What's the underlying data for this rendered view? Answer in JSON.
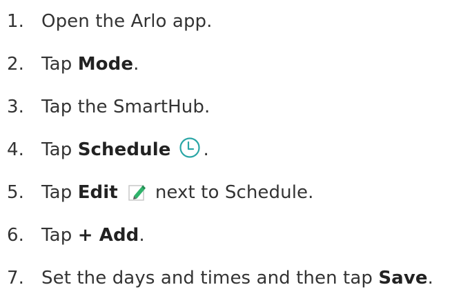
{
  "steps": [
    {
      "num": "1.",
      "text": "Open the Arlo app."
    },
    {
      "num": "2.",
      "pre": "Tap ",
      "bold": "Mode",
      "post": "."
    },
    {
      "num": "3.",
      "text": "Tap the SmartHub."
    },
    {
      "num": "4.",
      "pre": "Tap ",
      "bold": "Schedule",
      "icon": "clock-icon",
      "post": "."
    },
    {
      "num": "5.",
      "pre": "Tap ",
      "bold": "Edit",
      "icon": "edit-pencil-icon",
      "post": "next to Schedule."
    },
    {
      "num": "6.",
      "pre": "Tap ",
      "bold": "+ Add",
      "post": "."
    },
    {
      "num": "7.",
      "pre": "Set the days and times and then tap ",
      "bold": "Save",
      "post": "."
    }
  ],
  "colors": {
    "text": "#333333",
    "icon_teal": "#2aa6a6",
    "edit_green": "#2fb36b"
  }
}
